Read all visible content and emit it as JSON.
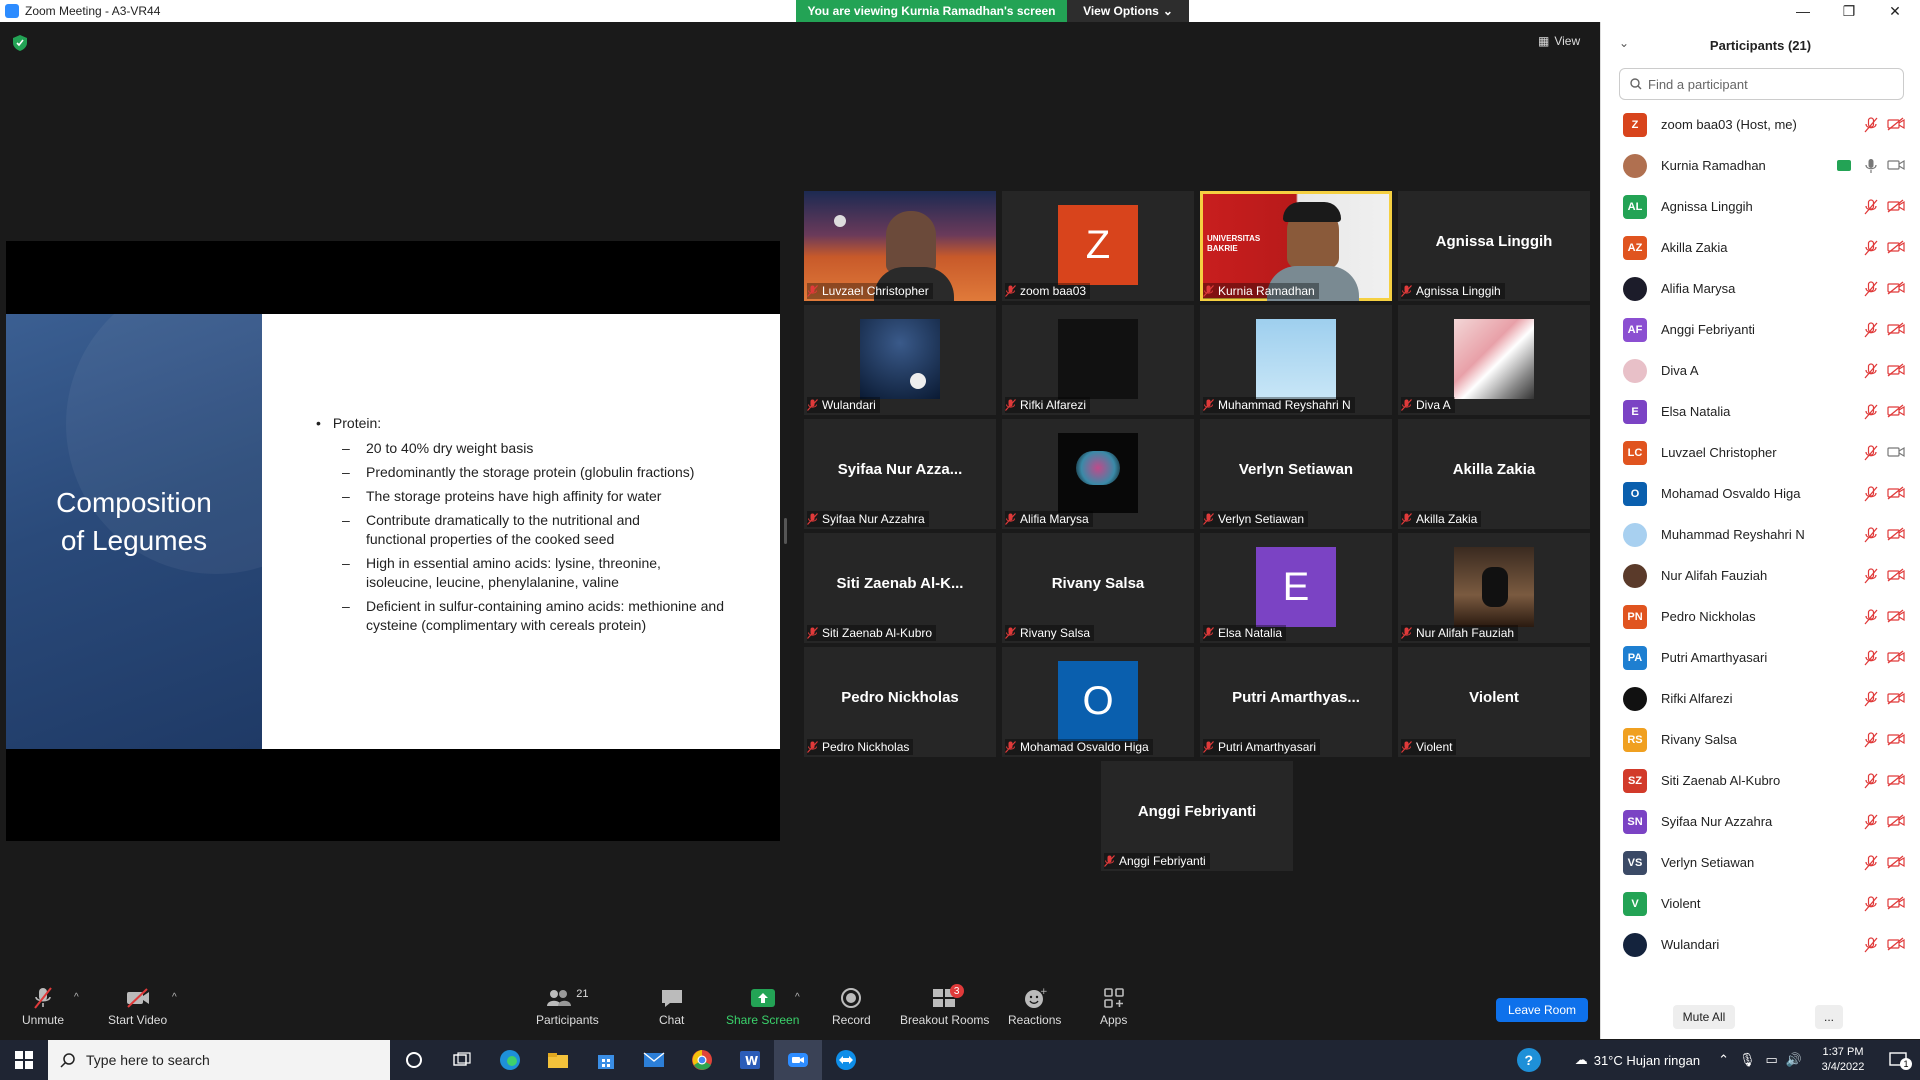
{
  "window": {
    "title": "Zoom Meeting - A3-VR44",
    "viewing_banner": "You are viewing Kurnia Ramadhan's screen",
    "view_options": "View Options"
  },
  "view_button": "View",
  "slide": {
    "title_line1": "Composition",
    "title_line2": "of Legumes",
    "main_bullet": "Protein:",
    "sub_bullets": [
      "20 to 40% dry weight basis",
      "Predominantly the storage protein (globulin fractions)",
      "The storage proteins have high affinity for water",
      "Contribute dramatically to the nutritional and functional properties of the cooked seed",
      "High in essential amino acids: lysine, threonine, isoleucine, leucine, phenylalanine, valine",
      "Deficient in sulfur-containing amino acids: methionine and cysteine (complimentary with cereals protein)"
    ]
  },
  "gallery": [
    {
      "label": "Luvzael Christopher",
      "kind": "photo-desert"
    },
    {
      "label": "zoom baa03",
      "kind": "letter",
      "letter": "Z",
      "color": "#d8441c"
    },
    {
      "label": "Kurnia Ramadhan",
      "kind": "photo-uni",
      "active": true,
      "banner": "UNIVERSITAS BAKRIE"
    },
    {
      "label": "Agnissa Linggih",
      "kind": "name",
      "big": "Agnissa Linggih"
    },
    {
      "label": "Wulandari",
      "kind": "photo-moon"
    },
    {
      "label": "Rifki Alfarezi",
      "kind": "photo-dark"
    },
    {
      "label": "Muhammad Reyshahri N",
      "kind": "photo-sky"
    },
    {
      "label": "Diva A",
      "kind": "photo-abstract"
    },
    {
      "label": "Syifaa Nur Azzahra",
      "kind": "name",
      "big": "Syifaa Nur Azza..."
    },
    {
      "label": "Alifia Marysa",
      "kind": "photo-tree"
    },
    {
      "label": "Verlyn Setiawan",
      "kind": "name",
      "big": "Verlyn Setiawan"
    },
    {
      "label": "Akilla Zakia",
      "kind": "name",
      "big": "Akilla Zakia"
    },
    {
      "label": "Siti Zaenab Al-Kubro",
      "kind": "name",
      "big": "Siti Zaenab Al-K..."
    },
    {
      "label": "Rivany Salsa",
      "kind": "name",
      "big": "Rivany Salsa"
    },
    {
      "label": "Elsa Natalia",
      "kind": "letter",
      "letter": "E",
      "color": "#7b43c4"
    },
    {
      "label": "Nur Alifah Fauziah",
      "kind": "photo-anime"
    },
    {
      "label": "Pedro Nickholas",
      "kind": "name",
      "big": "Pedro Nickholas"
    },
    {
      "label": "Mohamad Osvaldo Higa",
      "kind": "letter",
      "letter": "O",
      "color": "#0a5fae"
    },
    {
      "label": "Putri Amarthyasari",
      "kind": "name",
      "big": "Putri Amarthyas..."
    },
    {
      "label": "Violent",
      "kind": "name",
      "big": "Violent"
    },
    {
      "label": "Anggi Febriyanti",
      "kind": "name",
      "big": "Anggi Febriyanti"
    }
  ],
  "toolbar": {
    "unmute": "Unmute",
    "start_video": "Start Video",
    "participants": "Participants",
    "participants_count": "21",
    "chat": "Chat",
    "share_screen": "Share Screen",
    "record": "Record",
    "breakout_rooms": "Breakout Rooms",
    "breakout_badge": "3",
    "reactions": "Reactions",
    "apps": "Apps",
    "leave": "Leave Room"
  },
  "panel": {
    "title": "Participants (21)",
    "search_placeholder": "Find a participant",
    "mute_all": "Mute All",
    "more": "...",
    "participants": [
      {
        "name": "zoom baa03 (Host, me)",
        "initials": "Z",
        "color": "#d8441c"
      },
      {
        "name": "Kurnia Ramadhan",
        "initials": "",
        "color": "#b07050",
        "photo": true,
        "sharing": true
      },
      {
        "name": "Agnissa Linggih",
        "initials": "AL",
        "color": "#23a355"
      },
      {
        "name": "Akilla Zakia",
        "initials": "AZ",
        "color": "#e0541f"
      },
      {
        "name": "Alifia Marysa",
        "initials": "",
        "color": "#1c1c2a",
        "photo": true
      },
      {
        "name": "Anggi Febriyanti",
        "initials": "AF",
        "color": "#8b4fd1"
      },
      {
        "name": "Diva A",
        "initials": "",
        "color": "#e8c0c8",
        "photo": true
      },
      {
        "name": "Elsa Natalia",
        "initials": "E",
        "color": "#7b43c4"
      },
      {
        "name": "Luvzael Christopher",
        "initials": "LC",
        "color": "#e0541f"
      },
      {
        "name": "Mohamad Osvaldo Higa",
        "initials": "O",
        "color": "#0a5fae"
      },
      {
        "name": "Muhammad Reyshahri N",
        "initials": "",
        "color": "#a8d0f0",
        "photo": true
      },
      {
        "name": "Nur Alifah Fauziah",
        "initials": "",
        "color": "#5a3a2a",
        "photo": true
      },
      {
        "name": "Pedro Nickholas",
        "initials": "PN",
        "color": "#e0541f"
      },
      {
        "name": "Putri Amarthyasari",
        "initials": "PA",
        "color": "#1e7fd1"
      },
      {
        "name": "Rifki Alfarezi",
        "initials": "",
        "color": "#111111",
        "photo": true
      },
      {
        "name": "Rivany Salsa",
        "initials": "RS",
        "color": "#f0a020"
      },
      {
        "name": "Siti Zaenab Al-Kubro",
        "initials": "SZ",
        "color": "#d23a2a"
      },
      {
        "name": "Syifaa Nur Azzahra",
        "initials": "SN",
        "color": "#7b43c4"
      },
      {
        "name": "Verlyn Setiawan",
        "initials": "VS",
        "color": "#3b4a66"
      },
      {
        "name": "Violent",
        "initials": "V",
        "color": "#23a355"
      },
      {
        "name": "Wulandari",
        "initials": "",
        "color": "#14233d",
        "photo": true
      }
    ]
  },
  "taskbar": {
    "search_placeholder": "Type here to search",
    "weather": "31°C  Hujan ringan",
    "time": "1:37 PM",
    "date": "3/4/2022",
    "notification_count": "1"
  }
}
